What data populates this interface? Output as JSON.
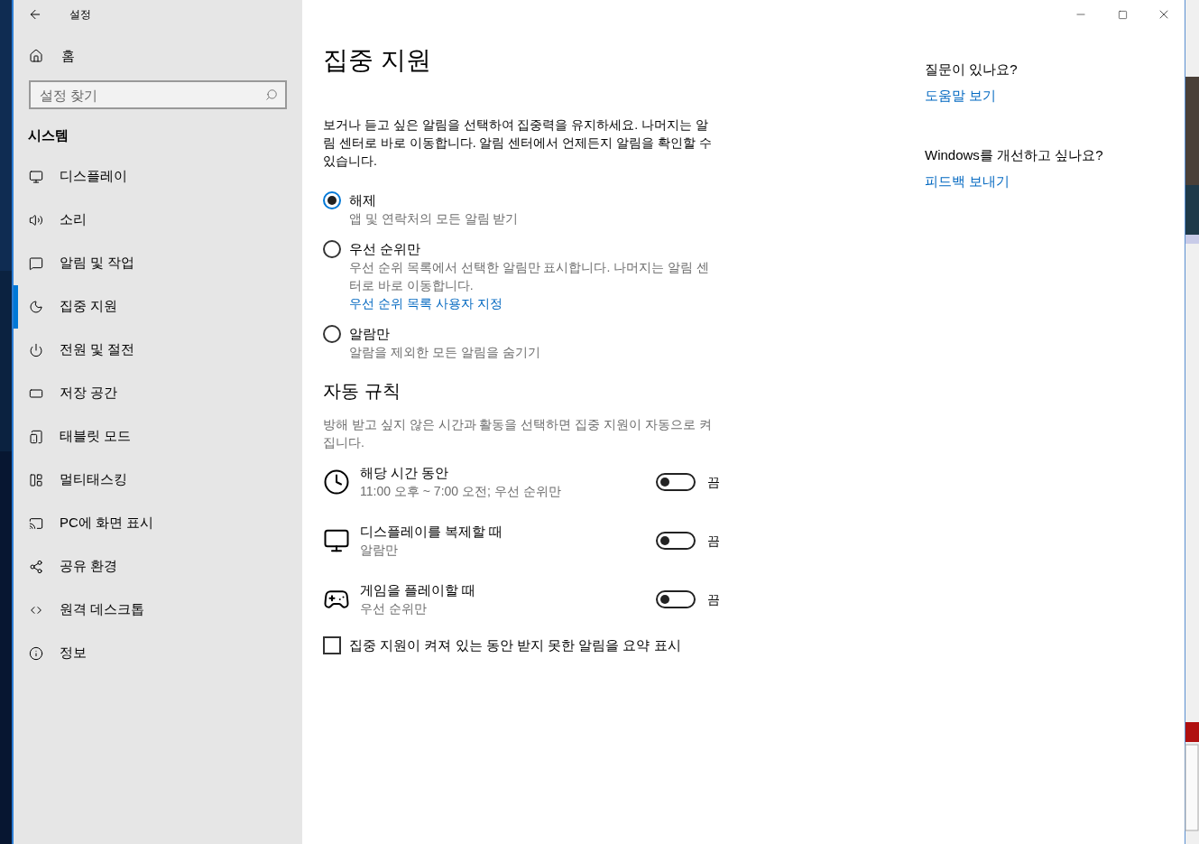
{
  "window": {
    "title": "설정"
  },
  "sidebar": {
    "home": "홈",
    "search": {
      "placeholder": "설정 찾기"
    },
    "section": "시스템",
    "items": [
      {
        "label": "디스플레이",
        "selected": false
      },
      {
        "label": "소리",
        "selected": false
      },
      {
        "label": "알림 및 작업",
        "selected": false
      },
      {
        "label": "집중 지원",
        "selected": true
      },
      {
        "label": "전원 및 절전",
        "selected": false
      },
      {
        "label": "저장 공간",
        "selected": false
      },
      {
        "label": "태블릿 모드",
        "selected": false
      },
      {
        "label": "멀티태스킹",
        "selected": false
      },
      {
        "label": "PC에 화면 표시",
        "selected": false
      },
      {
        "label": "공유 환경",
        "selected": false
      },
      {
        "label": "원격 데스크톱",
        "selected": false
      },
      {
        "label": "정보",
        "selected": false
      }
    ]
  },
  "main": {
    "title": "집중 지원",
    "intro": "보거나 듣고 싶은 알림을 선택하여 집중력을 유지하세요. 나머지는 알림 센터로 바로 이동합니다. 알림 센터에서 언제든지 알림을 확인할 수 있습니다.",
    "options": [
      {
        "label": "해제",
        "description": "앱 및 연락처의 모든 알림 받기",
        "selected": true
      },
      {
        "label": "우선 순위만",
        "description": "우선 순위 목록에서 선택한 알림만 표시합니다. 나머지는 알림 센터로 바로 이동합니다.",
        "link": "우선 순위 목록 사용자 지정",
        "selected": false
      },
      {
        "label": "알람만",
        "description": "알람을 제외한 모든 알림을 숨기기",
        "selected": false
      }
    ],
    "rules_heading": "자동 규칙",
    "rules_intro": "방해 받고 싶지 않은 시간과 활동을 선택하면 집중 지원이 자동으로 켜집니다.",
    "rules": [
      {
        "kind": "time",
        "title": "해당 시간 동안",
        "subtitle": "11:00 오후 ~ 7:00 오전; 우선 순위만",
        "on": false,
        "state": "끔"
      },
      {
        "kind": "display",
        "title": "디스플레이를 복제할 때",
        "subtitle": "알람만",
        "on": false,
        "state": "끔"
      },
      {
        "kind": "game",
        "title": "게임을 플레이할 때",
        "subtitle": "우선 순위만",
        "on": false,
        "state": "끔"
      }
    ],
    "summary_checkbox": {
      "label": "집중 지원이 켜져 있는 동안 받지 못한 알림을 요약 표시",
      "checked": false
    }
  },
  "aside": [
    {
      "question": "질문이 있나요?",
      "link": "도움말 보기"
    },
    {
      "question": "Windows를 개선하고 싶나요?",
      "link": "피드백 보내기"
    }
  ]
}
